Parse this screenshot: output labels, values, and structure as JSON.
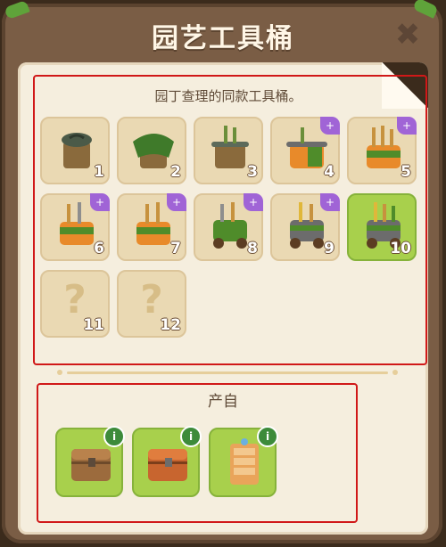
{
  "window": {
    "title": "园艺工具桶",
    "close_icon": "close-icon"
  },
  "collection": {
    "description": "园丁查理的同款工具桶。",
    "items": [
      {
        "num": "1",
        "upgrade": false,
        "locked": false,
        "selected": false,
        "icon": "bucket-lid-icon"
      },
      {
        "num": "2",
        "upgrade": false,
        "locked": false,
        "selected": false,
        "icon": "bucket-cloth-icon"
      },
      {
        "num": "3",
        "upgrade": false,
        "locked": false,
        "selected": false,
        "icon": "bucket-tools-icon"
      },
      {
        "num": "4",
        "upgrade": true,
        "locked": false,
        "selected": false,
        "icon": "orange-bucket-icon"
      },
      {
        "num": "5",
        "upgrade": true,
        "locked": false,
        "selected": false,
        "icon": "tools-bucket-icon"
      },
      {
        "num": "6",
        "upgrade": true,
        "locked": false,
        "selected": false,
        "icon": "tools-bucket-icon"
      },
      {
        "num": "7",
        "upgrade": true,
        "locked": false,
        "selected": false,
        "icon": "tools-bucket-icon"
      },
      {
        "num": "8",
        "upgrade": true,
        "locked": false,
        "selected": false,
        "icon": "tool-cart-icon"
      },
      {
        "num": "9",
        "upgrade": true,
        "locked": false,
        "selected": false,
        "icon": "tool-cart-icon"
      },
      {
        "num": "10",
        "upgrade": false,
        "locked": false,
        "selected": true,
        "icon": "tool-cart-icon"
      },
      {
        "num": "11",
        "upgrade": false,
        "locked": true,
        "selected": false,
        "icon": "question-mark-icon"
      },
      {
        "num": "12",
        "upgrade": false,
        "locked": true,
        "selected": false,
        "icon": "question-mark-icon"
      }
    ],
    "locked_glyph": "?",
    "upgrade_glyph": "+"
  },
  "output": {
    "title": "产自",
    "items": [
      {
        "icon": "wooden-chest-icon",
        "info": "i"
      },
      {
        "icon": "orange-chest-icon",
        "info": "i"
      },
      {
        "icon": "drawer-cabinet-icon",
        "info": "i"
      }
    ]
  },
  "colors": {
    "accent_green": "#a8d04c",
    "slot": "#ead9b3",
    "highlight_red": "#d01818",
    "upgrade_purple": "#a064d6"
  }
}
